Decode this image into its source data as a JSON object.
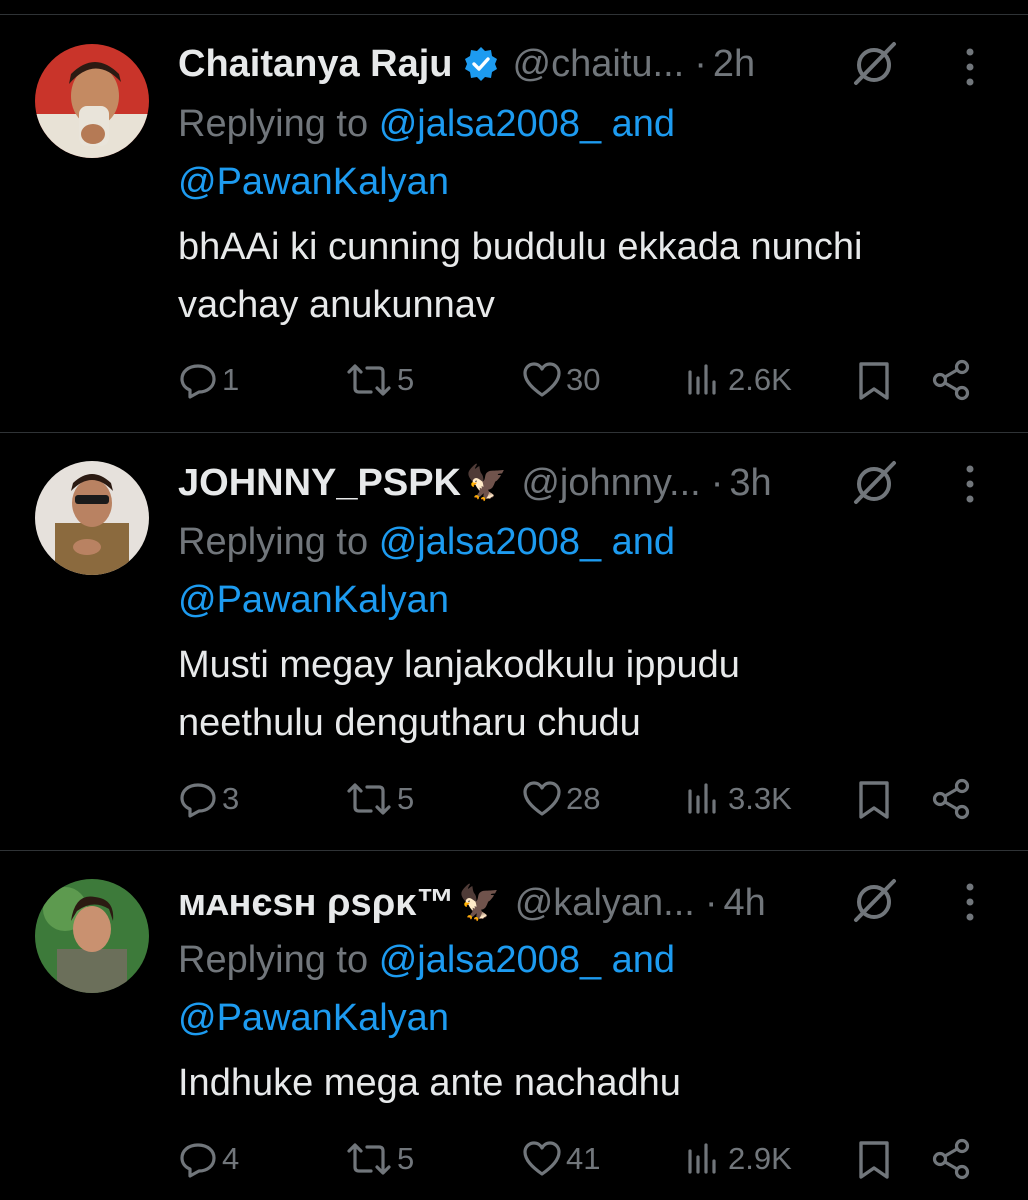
{
  "replying_prefix": "Replying to",
  "tweets": [
    {
      "name": "Chaitanya Raju",
      "verified": true,
      "handle": "@chaitu...",
      "sep": "·",
      "time": "2h",
      "mention1": "@jalsa2008_",
      "and": "and",
      "mention2": "@PawanKalyan",
      "text_line1": "bhAAi ki cunning buddulu ekkada nunchi",
      "text_line2": "vachay anukunnav",
      "replies": "1",
      "retweets": "5",
      "likes": "30",
      "views": "2.6K"
    },
    {
      "name": "JOHNNY_PSPK",
      "emoji": "🦅",
      "handle": "@johnny...",
      "sep": "·",
      "time": "3h",
      "mention1": "@jalsa2008_",
      "and": "and",
      "mention2": "@PawanKalyan",
      "text_line1": "Musti megay lanjakodkulu ippudu",
      "text_line2": "neethulu dengutharu chudu",
      "replies": "3",
      "retweets": "5",
      "likes": "28",
      "views": "3.3K"
    },
    {
      "name": "ᴍᴀнєѕн ρѕρκ™",
      "emoji": "🦅",
      "handle": "@kalyan...",
      "sep": "·",
      "time": "4h",
      "mention1": "@jalsa2008_",
      "and": "and",
      "mention2": "@PawanKalyan",
      "text_line1": "Indhuke mega ante nachadhu",
      "replies": "4",
      "retweets": "5",
      "likes": "41",
      "views": "2.9K"
    }
  ],
  "colors": {
    "background": "#000000",
    "text": "#e7e9ea",
    "muted": "#71767b",
    "link": "#1d9bf0",
    "divider": "#2f3336"
  },
  "icons": [
    "verified-badge-icon",
    "eagle-emoji",
    "grok-icon",
    "more-icon",
    "reply-icon",
    "retweet-icon",
    "like-icon",
    "views-icon",
    "bookmark-icon",
    "share-icon"
  ]
}
